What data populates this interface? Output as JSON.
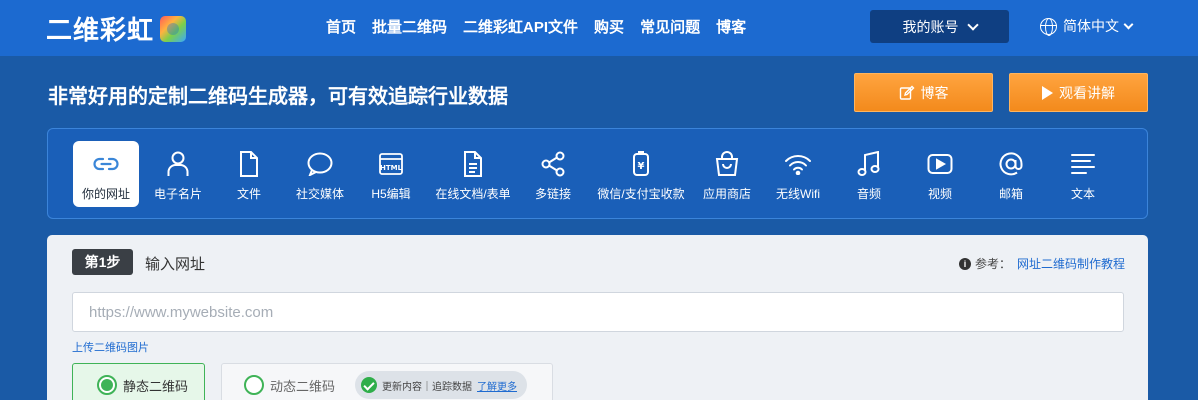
{
  "header": {
    "logo_text": "二维彩虹",
    "nav": [
      "首页",
      "批量二维码",
      "二维彩虹API文件",
      "购买",
      "常见问题",
      "博客"
    ],
    "account_label": "我的账号",
    "language_label": "简体中文"
  },
  "hero": {
    "title": "非常好用的定制二维码生成器，可有效追踪行业数据",
    "blog_button": "博客",
    "video_button": "观看讲解"
  },
  "types": [
    {
      "label": "你的网址",
      "icon": "link-icon",
      "active": true
    },
    {
      "label": "电子名片",
      "icon": "person-icon"
    },
    {
      "label": "文件",
      "icon": "file-icon"
    },
    {
      "label": "社交媒体",
      "icon": "chat-bubble-icon"
    },
    {
      "label": "H5编辑",
      "icon": "html-icon"
    },
    {
      "label": "在线文档/表单",
      "icon": "document-icon"
    },
    {
      "label": "多链接",
      "icon": "share-icon"
    },
    {
      "label": "微信/支付宝收款",
      "icon": "payment-icon"
    },
    {
      "label": "应用商店",
      "icon": "shopping-bag-icon"
    },
    {
      "label": "无线Wifi",
      "icon": "wifi-icon"
    },
    {
      "label": "音频",
      "icon": "music-icon"
    },
    {
      "label": "视频",
      "icon": "play-icon"
    },
    {
      "label": "邮箱",
      "icon": "at-icon"
    },
    {
      "label": "文本",
      "icon": "text-lines-icon"
    }
  ],
  "step": {
    "badge": "第1步",
    "title": "输入网址",
    "ref_label": "参考：",
    "ref_link": "网址二维码制作教程",
    "url_placeholder": "https://www.mywebsite.com",
    "upload_link": "上传二维码图片",
    "static_label": "静态二维码",
    "dynamic_label": "动态二维码",
    "dynamic_pill_text": "更新内容｜追踪数据",
    "dynamic_pill_link": "了解更多"
  },
  "colors": {
    "header_bg": "#1c6ad0",
    "page_bg": "#1a5aa6",
    "accent_orange": "#f7941d",
    "success_green": "#3fb357"
  }
}
